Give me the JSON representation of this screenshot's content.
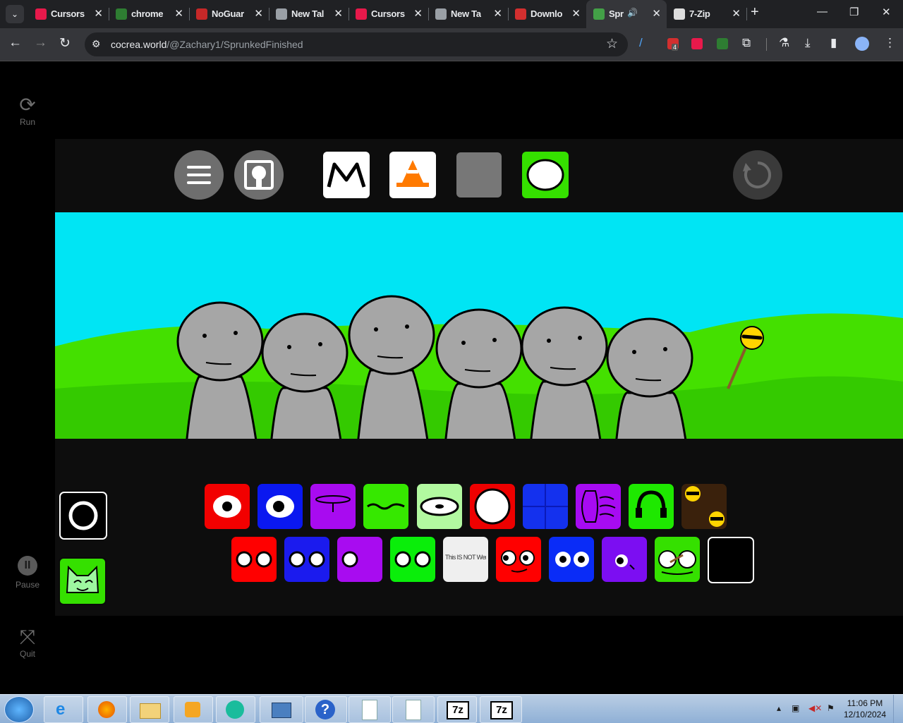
{
  "browser": {
    "tabs": [
      {
        "title": "Cursors",
        "favicon_color": "#e8194b"
      },
      {
        "title": "chrome",
        "favicon_color": "#2e7d32"
      },
      {
        "title": "NoGuar",
        "favicon_color": "#c62828"
      },
      {
        "title": "New Tal",
        "favicon_color": "#9aa0a6"
      },
      {
        "title": "Cursors",
        "favicon_color": "#e8194b"
      },
      {
        "title": "New Ta",
        "favicon_color": "#9aa0a6"
      },
      {
        "title": "Downlo",
        "favicon_color": "#d32f2f"
      },
      {
        "title": "Spr",
        "favicon_color": "#43a047",
        "active": true,
        "audio": true
      },
      {
        "title": "7-Zip",
        "favicon_color": "#dddddd"
      }
    ],
    "url_host": "cocrea.world",
    "url_path": "/@Zachary1/SprunkedFinished",
    "ext_badge": "4"
  },
  "rail": {
    "run_label": "Run",
    "pause_label": "Pause",
    "quit_label": "Quit"
  },
  "game": {
    "stage_colors": {
      "sky": "#00e5f4",
      "grass": "#44e000",
      "character": "#a6a6a6"
    },
    "top_buttons": [
      "menu",
      "background",
      "mode-m",
      "cone",
      "gray",
      "speech"
    ],
    "sound_row1": [
      "#f20000",
      "#0a18f0",
      "#a80bf0",
      "#36e800",
      "#b2f9a0",
      "#ee0000",
      "#1431ee",
      "#a70bf2",
      "#1ee800",
      "#3a210c"
    ],
    "sound_row2": [
      "#ff0000",
      "#1b1bee",
      "#a80cf0",
      "#0aee0a",
      "#efefef",
      "#ff0000",
      "#0a2cf7",
      "#7c0ef2",
      "#35e000",
      "#000000"
    ],
    "sound_row2_text": "This IS NOT Wenda"
  },
  "taskbar": {
    "time": "11:06 PM",
    "date": "12/10/2024",
    "zip_label": "7z"
  }
}
